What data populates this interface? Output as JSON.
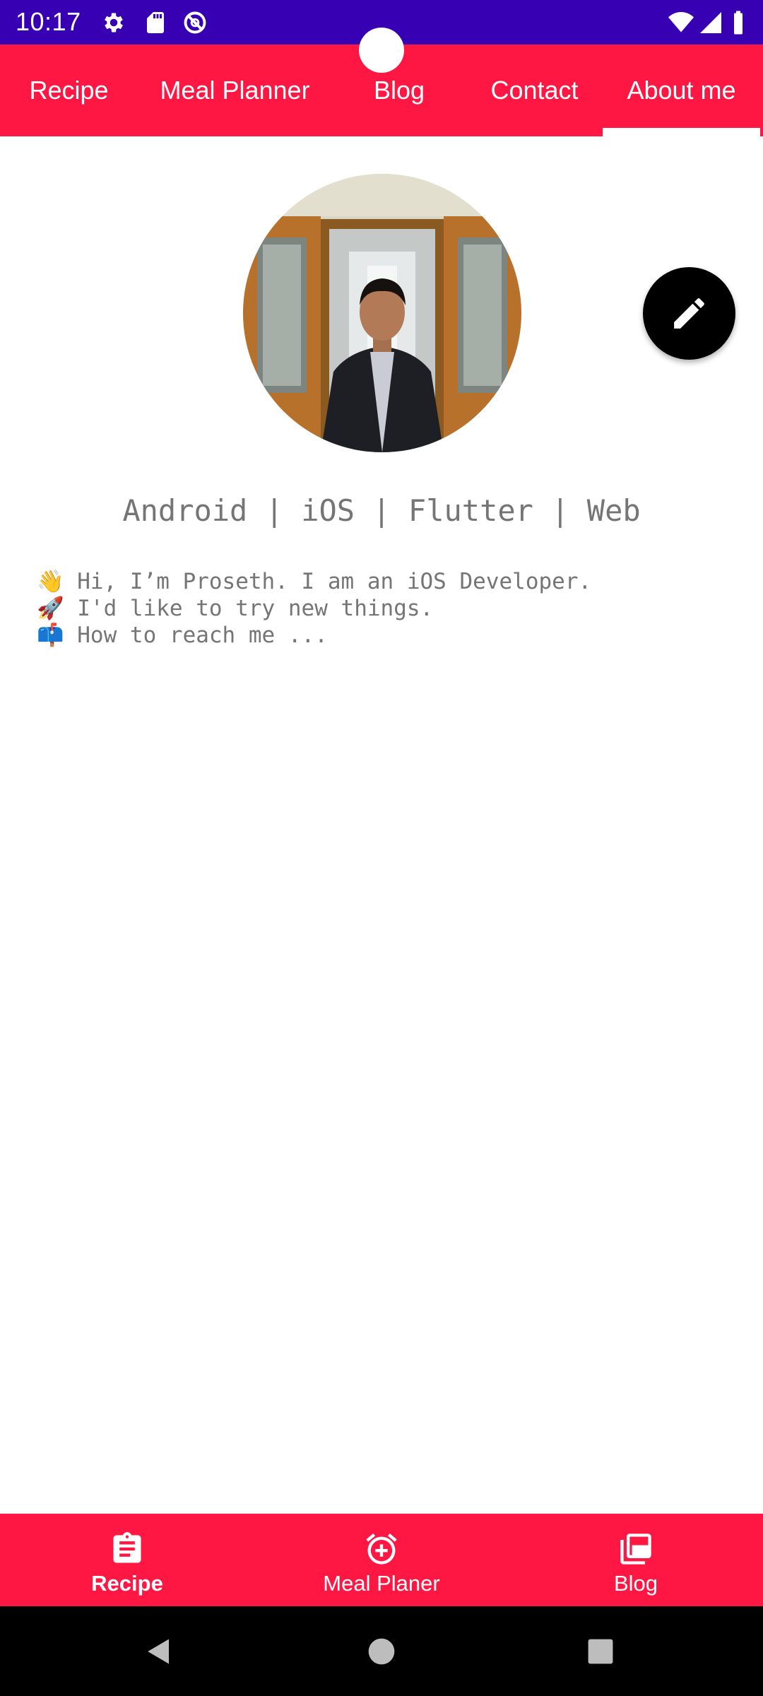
{
  "status_bar": {
    "time": "10:17",
    "left_icons": [
      "settings-icon",
      "sd-card-icon",
      "do-not-disturb-icon"
    ],
    "right_icons": [
      "wifi-icon",
      "signal-icon",
      "battery-icon"
    ],
    "background": "#3700b3"
  },
  "top_tabs": {
    "background": "#ff1744",
    "items": [
      {
        "label": "Recipe"
      },
      {
        "label": "Meal Planner"
      },
      {
        "label": "Blog"
      },
      {
        "label": "Contact"
      },
      {
        "label": "About me"
      }
    ],
    "selected_index": 4
  },
  "profile": {
    "tagline": "Android | iOS | Flutter | Web",
    "bio_lines": [
      "👋 Hi, I’m Proseth. I am an iOS Developer.",
      "🚀 I'd like to try new things.",
      "📫 How to reach me ..."
    ]
  },
  "fab": {
    "icon": "edit-pencil-icon"
  },
  "bottom_nav": {
    "background": "#ff1744",
    "items": [
      {
        "label": "Recipe",
        "icon": "clipboard-icon",
        "active": true
      },
      {
        "label": "Meal Planer",
        "icon": "alarm-add-icon",
        "active": false
      },
      {
        "label": "Blog",
        "icon": "library-icon",
        "active": false
      }
    ]
  },
  "system_nav": [
    "back-icon",
    "home-icon",
    "recents-icon"
  ]
}
